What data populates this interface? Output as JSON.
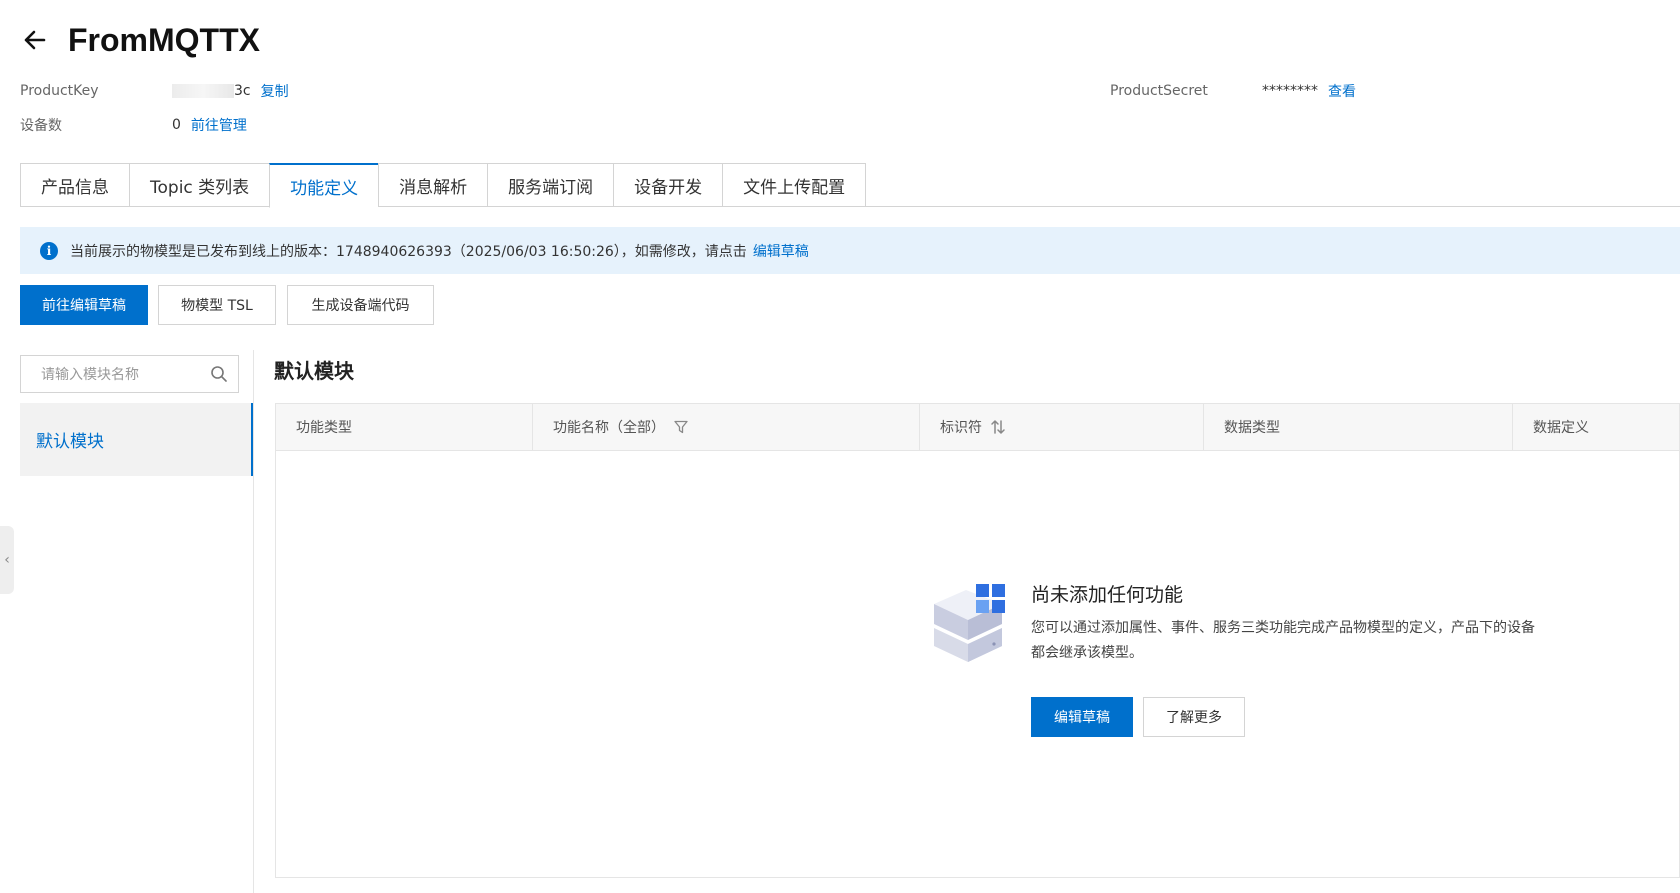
{
  "header": {
    "title": "FromMQTTX"
  },
  "info": {
    "product_key_label": "ProductKey",
    "product_key_suffix": "3c",
    "copy_link": "复制",
    "product_secret_label": "ProductSecret",
    "product_secret_value": "********",
    "view_link": "查看",
    "device_count_label": "设备数",
    "device_count_value": "0",
    "manage_link": "前往管理"
  },
  "tabs": [
    {
      "label": "产品信息"
    },
    {
      "label": "Topic 类列表"
    },
    {
      "label": "功能定义",
      "active": true
    },
    {
      "label": "消息解析"
    },
    {
      "label": "服务端订阅"
    },
    {
      "label": "设备开发"
    },
    {
      "label": "文件上传配置"
    }
  ],
  "alert": {
    "text": "当前展示的物模型是已发布到线上的版本：1748940626393（2025/06/03 16:50:26），如需修改，请点击",
    "link": "编辑草稿"
  },
  "actions": {
    "edit_draft": "前往编辑草稿",
    "tsl": "物模型 TSL",
    "gen_code": "生成设备端代码"
  },
  "sidebar": {
    "search_placeholder": "请输入模块名称",
    "items": [
      {
        "label": "默认模块",
        "active": true
      }
    ]
  },
  "main": {
    "module_title": "默认模块",
    "columns": [
      "功能类型",
      "功能名称（全部）",
      "标识符",
      "数据类型",
      "数据定义"
    ],
    "empty": {
      "title": "尚未添加任何功能",
      "description": "您可以通过添加属性、事件、服务三类功能完成产品物模型的定义，产品下的设备都会继承该模型。",
      "primary_button": "编辑草稿",
      "secondary_button": "了解更多"
    }
  },
  "colors": {
    "accent": "#0070cc",
    "alert_bg": "#e6f2fc"
  }
}
